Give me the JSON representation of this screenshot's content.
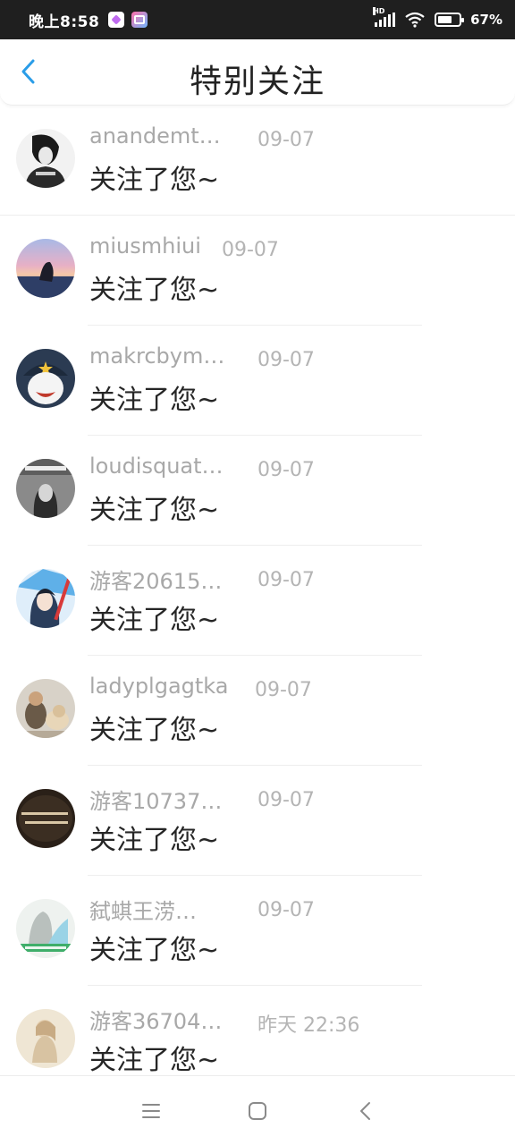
{
  "status_bar": {
    "time": "晚上8:58",
    "network_label": "HD",
    "battery_percent": "67%",
    "battery_level": 0.67
  },
  "header": {
    "title": "特别关注",
    "accent_color": "#2a9de8"
  },
  "items": [
    {
      "name": "anandemt…",
      "time": "09-07",
      "message": "关注了您~",
      "avatar_icon": "avatar-black-white-girl"
    },
    {
      "name": "miusmhiui",
      "time": "09-07",
      "message": "关注了您~",
      "avatar_icon": "avatar-sunset-sea"
    },
    {
      "name": "makrcbym…",
      "time": "09-07",
      "message": "关注了您~",
      "avatar_icon": "avatar-cartoon-character"
    },
    {
      "name": "loudisquat…",
      "time": "09-07",
      "message": "关注了您~",
      "avatar_icon": "avatar-gray-portrait"
    },
    {
      "name": "游客20615…",
      "time": "09-07",
      "message": "关注了您~",
      "avatar_icon": "avatar-anime-boy"
    },
    {
      "name": "ladyplgagtka",
      "time": "09-07",
      "message": "关注了您~",
      "avatar_icon": "avatar-child-with-dog"
    },
    {
      "name": "游客10737…",
      "time": "09-07",
      "message": "关注了您~",
      "avatar_icon": "avatar-dark-text"
    },
    {
      "name": "弑蜞王涝…",
      "time": "09-07",
      "message": "关注了您~",
      "avatar_icon": "avatar-light-green"
    },
    {
      "name": "游客36704…",
      "time": "昨天 22:36",
      "message": "关注了您~",
      "avatar_icon": "avatar-beige-illustration"
    }
  ],
  "nav": {
    "menu_icon": "menu-icon",
    "home_icon": "home-icon",
    "back_icon": "back-triangle-icon"
  }
}
